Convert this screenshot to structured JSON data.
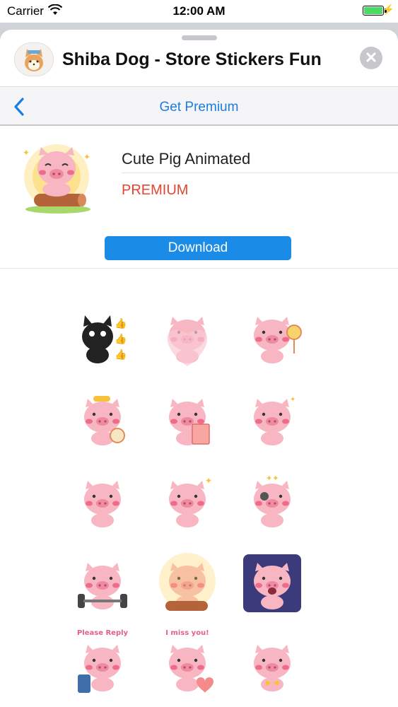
{
  "status": {
    "carrier": "Carrier",
    "time": "12:00 AM"
  },
  "header": {
    "title": "Shiba Dog - Store Stickers Fun",
    "close_glyph": "✕"
  },
  "nav": {
    "title": "Get Premium"
  },
  "pack": {
    "name": "Cute Pig Animated",
    "tier": "PREMIUM",
    "download_label": "Download"
  },
  "stickers": [
    {
      "name": "cat-thumbs-up"
    },
    {
      "name": "pig-heart"
    },
    {
      "name": "pig-fan"
    },
    {
      "name": "pig-alarm"
    },
    {
      "name": "pig-notebook"
    },
    {
      "name": "pig-pray"
    },
    {
      "name": "pig-blush"
    },
    {
      "name": "pig-sparkle"
    },
    {
      "name": "pig-dizzy"
    },
    {
      "name": "pig-weights"
    },
    {
      "name": "pig-log"
    },
    {
      "name": "pig-shocked"
    },
    {
      "name": "pig-please-reply",
      "text": "Please Reply"
    },
    {
      "name": "pig-miss-you",
      "text": "I miss you!"
    },
    {
      "name": "pig-bowtie"
    }
  ],
  "colors": {
    "accent": "#1a7ee0",
    "premium": "#e2462f",
    "button": "#1a8be6",
    "pig": "#f7b6c2"
  }
}
